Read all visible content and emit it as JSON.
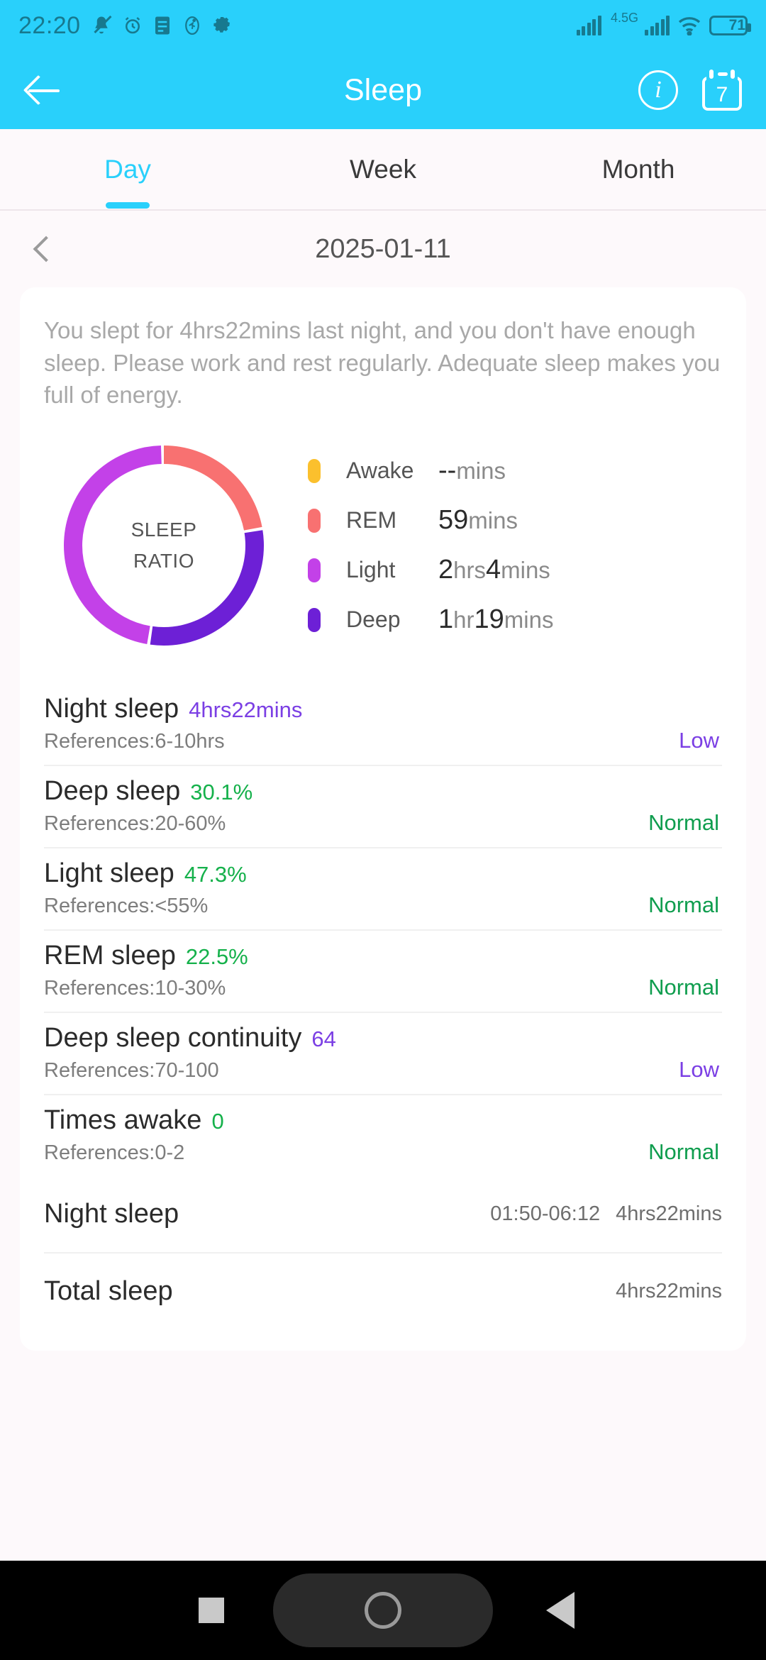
{
  "status_bar": {
    "time": "22:20",
    "network_label": "4.5G",
    "battery_level": "71",
    "icons": [
      "bell-mute-icon",
      "alarm-clock-icon",
      "list-icon",
      "run-icon",
      "gear-icon"
    ]
  },
  "app_bar": {
    "title": "Sleep",
    "back_icon": "back-arrow-icon",
    "info_icon": "info-icon",
    "info_glyph": "i",
    "calendar_icon": "calendar-icon",
    "calendar_day": "7"
  },
  "tabs": [
    {
      "label": "Day",
      "active": true
    },
    {
      "label": "Week",
      "active": false
    },
    {
      "label": "Month",
      "active": false
    }
  ],
  "date_nav": {
    "prev_icon": "chevron-left-icon",
    "date": "2025-01-11"
  },
  "card": {
    "summary": "You slept for 4hrs22mins last night, and you don't have enough sleep. Please work and rest regularly. Adequate sleep makes you full of energy.",
    "donut_center_line1": "SLEEP",
    "donut_center_line2": "RATIO"
  },
  "chart_data": {
    "type": "pie",
    "title": "SLEEP RATIO",
    "categories": [
      "Awake",
      "REM",
      "Light",
      "Deep"
    ],
    "values": [
      0,
      59,
      124,
      79
    ],
    "value_unit": "minutes",
    "value_labels": [
      "--mins",
      "59mins",
      "2hrs4mins",
      "1hr19mins"
    ],
    "percentages": [
      0,
      22.5,
      47.3,
      30.1
    ],
    "colors": [
      "#fbc02d",
      "#f87171",
      "#c341e8",
      "#6d20d6"
    ],
    "legend_position": "right",
    "total_minutes": 262,
    "total_label": "4hrs22mins"
  },
  "legend": [
    {
      "label": "Awake",
      "num": "--",
      "unit": "mins",
      "color": "#fbc02d"
    },
    {
      "label": "REM",
      "num": "59",
      "unit": "mins",
      "color": "#f87171"
    },
    {
      "label": "Light",
      "num_a": "2",
      "unit_a": "hrs",
      "num_b": "4",
      "unit_b": "mins",
      "color": "#c341e8"
    },
    {
      "label": "Deep",
      "num_a": "1",
      "unit_a": "hr",
      "num_b": "19",
      "unit_b": "mins",
      "color": "#6d20d6"
    }
  ],
  "metrics": [
    {
      "title": "Night sleep",
      "value": "4hrs22mins",
      "value_color": "purple",
      "reference": "References:6-10hrs",
      "status": "Low",
      "status_class": "low"
    },
    {
      "title": "Deep sleep",
      "value": "30.1%",
      "value_color": "green",
      "reference": "References:20-60%",
      "status": "Normal",
      "status_class": "normal"
    },
    {
      "title": "Light sleep",
      "value": "47.3%",
      "value_color": "green",
      "reference": "References:<55%",
      "status": "Normal",
      "status_class": "normal"
    },
    {
      "title": "REM sleep",
      "value": "22.5%",
      "value_color": "green",
      "reference": "References:10-30%",
      "status": "Normal",
      "status_class": "normal"
    },
    {
      "title": "Deep sleep continuity",
      "value": "64",
      "value_color": "purple",
      "reference": "References:70-100",
      "status": "Low",
      "status_class": "low"
    },
    {
      "title": "Times awake",
      "value": "0",
      "value_color": "green",
      "reference": "References:0-2",
      "status": "Normal",
      "status_class": "normal"
    }
  ],
  "summary_rows": [
    {
      "label": "Night sleep",
      "range": "01:50-06:12",
      "duration": "4hrs22mins"
    },
    {
      "label": "Total sleep",
      "range": "",
      "duration": "4hrs22mins"
    }
  ],
  "nav_bar": {
    "recent_icon": "square-recents-icon",
    "home_icon": "home-circle-icon",
    "back_icon": "triangle-back-icon"
  }
}
